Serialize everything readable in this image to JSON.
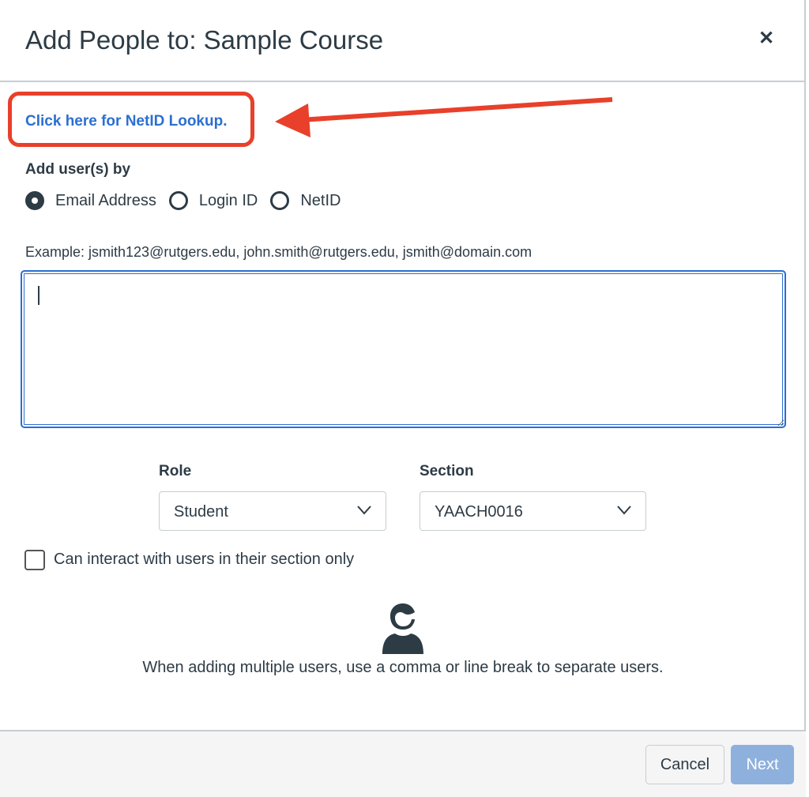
{
  "dialog": {
    "title": "Add People to: Sample Course",
    "close_icon": "close-icon"
  },
  "netid_link": "Click here for NetID Lookup.",
  "annotation": {
    "color": "#e8402a"
  },
  "add_by": {
    "label": "Add user(s) by",
    "options": [
      "Email Address",
      "Login ID",
      "NetID"
    ],
    "selected": "Email Address"
  },
  "example": "Example: jsmith123@rutgers.edu, john.smith@rutgers.edu, jsmith@domain.com",
  "users_input": {
    "value": ""
  },
  "role": {
    "label": "Role",
    "value": "Student"
  },
  "section": {
    "label": "Section",
    "value": "YAACH0016"
  },
  "section_only": {
    "label": "Can interact with users in their section only",
    "checked": false
  },
  "hint": "When adding multiple users, use a comma or line break to separate users.",
  "footer": {
    "cancel": "Cancel",
    "next": "Next"
  },
  "colors": {
    "link": "#2b6fd1",
    "next_disabled": "#8eb0dd",
    "text": "#2d3b45"
  }
}
